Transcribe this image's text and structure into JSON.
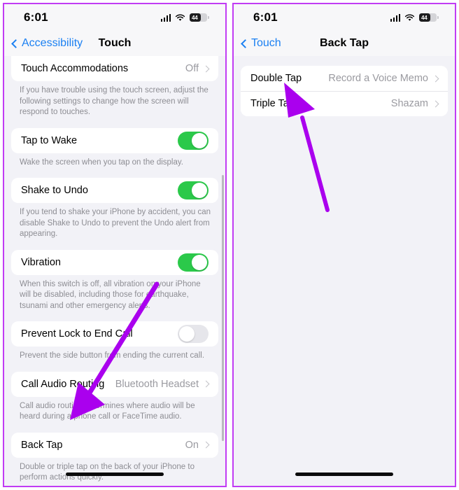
{
  "accent": {
    "annotation_purple": "#AA00EE",
    "border_purple": "#C13CF4",
    "ios_blue": "#1B80F2",
    "toggle_green": "#2BC94A"
  },
  "panels": [
    {
      "name": "touch-settings",
      "status": {
        "time": "6:01",
        "signal_icon": "cellular-signal-icon",
        "wifi_icon": "wifi-icon",
        "battery_icon": "battery-icon",
        "battery_level": "44"
      },
      "nav": {
        "back_label": "Accessibility",
        "back_icon": "chevron-left-icon",
        "title": "Touch"
      },
      "sections": [
        {
          "rows": [
            {
              "label": "Touch Accommodations",
              "value": "Off",
              "control": "disclosure",
              "icon": "chevron-right-icon"
            }
          ],
          "footnote": "If you have trouble using the touch screen, adjust the following settings to change how the screen will respond to touches."
        },
        {
          "rows": [
            {
              "label": "Tap to Wake",
              "control": "toggle",
              "toggle_state": "on"
            }
          ],
          "footnote": "Wake the screen when you tap on the display."
        },
        {
          "rows": [
            {
              "label": "Shake to Undo",
              "control": "toggle",
              "toggle_state": "on"
            }
          ],
          "footnote": "If you tend to shake your iPhone by accident, you can disable Shake to Undo to prevent the Undo alert from appearing."
        },
        {
          "rows": [
            {
              "label": "Vibration",
              "control": "toggle",
              "toggle_state": "on"
            }
          ],
          "footnote": "When this switch is off, all vibration on your iPhone will be disabled, including those for earthquake, tsunami and other emergency alerts."
        },
        {
          "rows": [
            {
              "label": "Prevent Lock to End Call",
              "control": "toggle",
              "toggle_state": "off"
            }
          ],
          "footnote": "Prevent the side button from ending the current call."
        },
        {
          "rows": [
            {
              "label": "Call Audio Routing",
              "value": "Bluetooth Headset",
              "control": "disclosure",
              "icon": "chevron-right-icon"
            }
          ],
          "footnote": "Call audio routing determines where audio will be heard during a phone call or FaceTime audio."
        },
        {
          "rows": [
            {
              "label": "Back Tap",
              "value": "On",
              "control": "disclosure",
              "icon": "chevron-right-icon"
            }
          ],
          "footnote": "Double or triple tap on the back of your iPhone to perform actions quickly."
        }
      ]
    },
    {
      "name": "back-tap-settings",
      "status": {
        "time": "6:01",
        "signal_icon": "cellular-signal-icon",
        "wifi_icon": "wifi-icon",
        "battery_icon": "battery-icon",
        "battery_level": "44"
      },
      "nav": {
        "back_label": "Touch",
        "back_icon": "chevron-left-icon",
        "title": "Back Tap"
      },
      "sections": [
        {
          "rows": [
            {
              "label": "Double Tap",
              "value": "Record a Voice Memo",
              "control": "disclosure",
              "icon": "chevron-right-icon"
            },
            {
              "label": "Triple Tap",
              "value": "Shazam",
              "control": "disclosure",
              "icon": "chevron-right-icon"
            }
          ],
          "footnote": ""
        }
      ]
    }
  ],
  "annotations": [
    {
      "name": "arrow-to-back-tap",
      "points_to": "Back Tap"
    },
    {
      "name": "arrow-to-double-tap",
      "points_to": "Double Tap"
    }
  ]
}
